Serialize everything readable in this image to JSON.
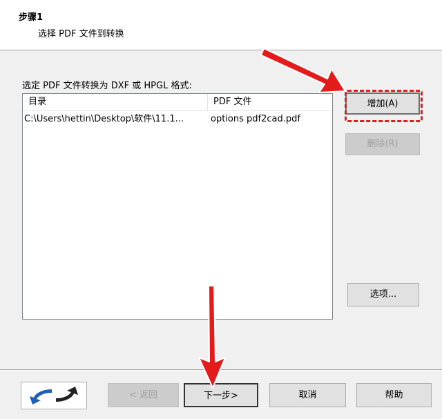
{
  "header": {
    "step_title": "步骤1",
    "step_description": "选择 PDF 文件到转换"
  },
  "list": {
    "caption": "选定 PDF 文件转换为 DXF 或 HPGL 格式:",
    "columns": [
      "目录",
      "PDF 文件"
    ],
    "rows": [
      {
        "directory": "C:\\Users\\hettin\\Desktop\\软件\\11.1...",
        "file": "options pdf2cad.pdf"
      }
    ]
  },
  "side_buttons": {
    "add": "增加(A)",
    "remove": "删除(R)",
    "options": "选项..."
  },
  "footer": {
    "back": "< 返回",
    "next": "下一步>",
    "cancel": "取消",
    "help": "帮助"
  },
  "colors": {
    "annotation_red": "#e31b1b",
    "logo_blue": "#1f5fb3"
  }
}
